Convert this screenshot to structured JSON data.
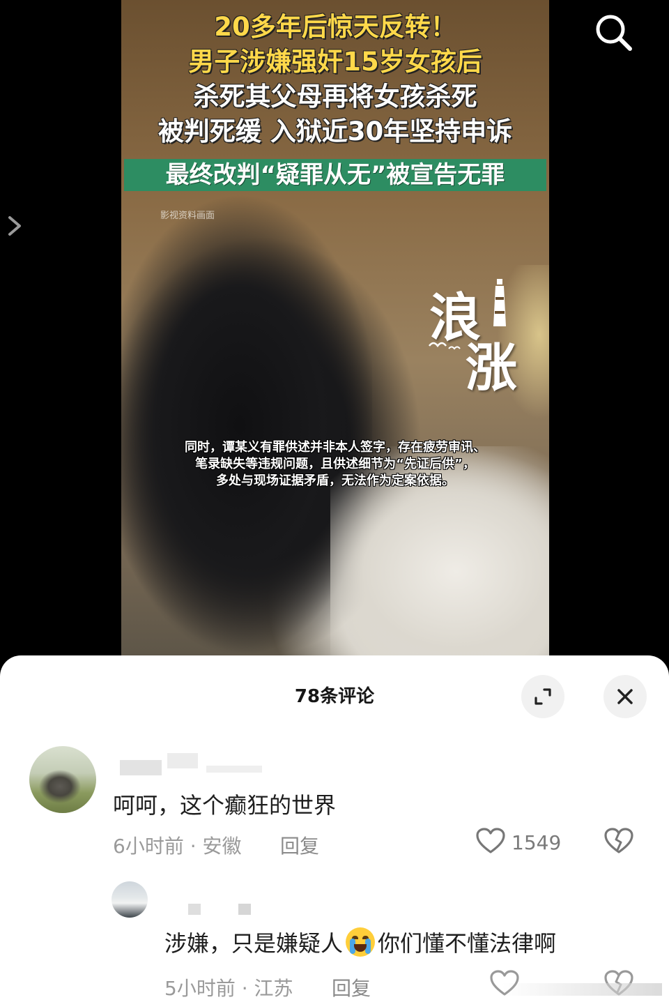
{
  "video": {
    "title_lines": [
      "20多年后惊天反转！",
      "男子涉嫌强奸15岁女孩后",
      "杀死其父母再将女孩杀死",
      "被判死缓 入狱近30年坚持申诉"
    ],
    "banner": "最终改判“疑罪从无”被宣告无罪",
    "watermark": "影视资料画面",
    "brand_chars": [
      "浪",
      "涨"
    ],
    "subtitle_lines": [
      "同时，谭某义有罪供述并非本人签字，存在疲劳审讯、",
      "笔录缺失等违规问题，且供述细节为“先证后供”，",
      "多处与现场证据矛盾，无法作为定案依据。"
    ],
    "colors": {
      "title_yellow": "#ffd84a",
      "banner_green": "#2d8d62"
    }
  },
  "sheet": {
    "title": "78条评论",
    "expand_icon": "expand-icon",
    "close_icon": "close-icon"
  },
  "comments": [
    {
      "text": "呵呵，这个癫狂的世界",
      "time_location": "6小时前 · 安徽",
      "reply_label": "回复",
      "likes": "1549"
    },
    {
      "text_before_emoji": "涉嫌，只是嫌疑人",
      "emoji": "crying-emoji",
      "text_after_emoji": "你们懂不懂法律啊",
      "time_location": "5小时前 · 江苏",
      "reply_label": "回复"
    }
  ]
}
